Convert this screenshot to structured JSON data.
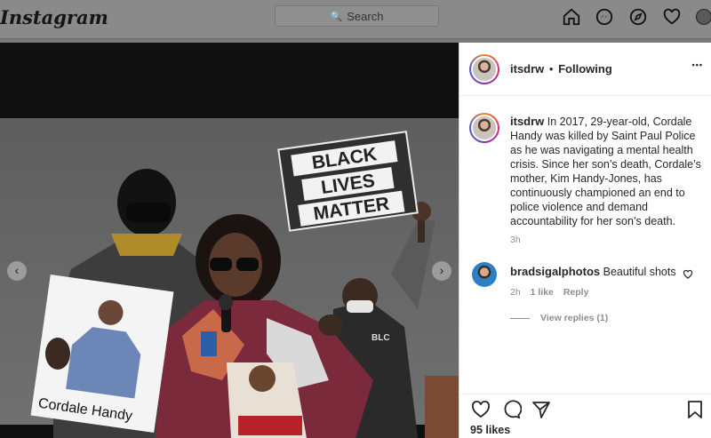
{
  "app": {
    "logo_text": "Instagram"
  },
  "search": {
    "placeholder": "Search"
  },
  "nav_icons": [
    "home-icon",
    "messenger-icon",
    "explore-icon",
    "heart-icon",
    "profile-avatar"
  ],
  "photo": {
    "sign_lines": [
      "BLACK",
      "LIVES",
      "MATTER"
    ],
    "poster_caption": "Cordale Handy",
    "hoodie_text": "BLC"
  },
  "post": {
    "username": "itsdrw",
    "follow_separator": "•",
    "follow_status": "Following",
    "more_icon": "•••",
    "caption_user": "itsdrw",
    "caption_text": "In 2017, 29-year-old, Cordale Handy was killed by Saint Paul Police as he was navigating a mental health crisis. Since her son’s death, Cordale’s mother, Kim Handy-Jones, has continuously championed an end to police violence and demand accountability for her son’s death.",
    "caption_time": "3h",
    "comment": {
      "user": "bradsigalphotos",
      "text": "Beautiful shots",
      "time": "2h",
      "likes": "1 like",
      "reply": "Reply",
      "view_replies": "View replies (1)"
    },
    "likes_count": "95 likes"
  },
  "colors": {
    "overlay": "#7a7a7a",
    "text": "#262626",
    "muted": "#8e8e8e",
    "link": "#0095f6"
  }
}
